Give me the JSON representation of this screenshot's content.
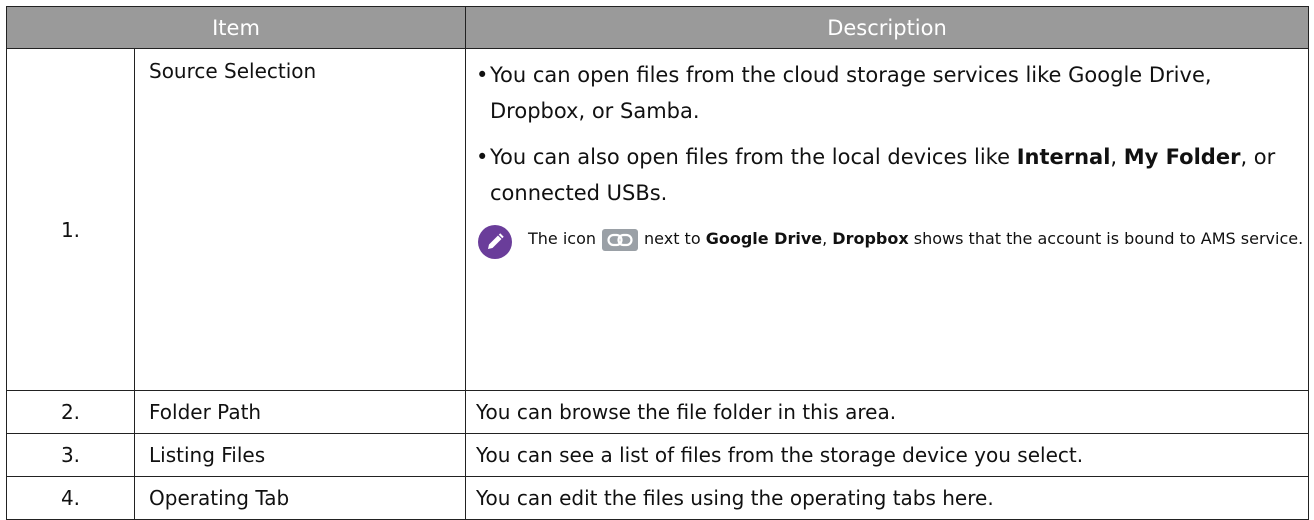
{
  "header": {
    "item": "Item",
    "description": "Description"
  },
  "rows": [
    {
      "number": "1.",
      "name": "Source Selection",
      "bullet_char": "•",
      "bullet1": "You can open files from the cloud storage services like Google Drive, Dropbox, or Samba.",
      "bullet2": {
        "pre": "You can also open files from the local devices like ",
        "bold1": "Internal",
        "sep": ", ",
        "bold2": "My Folder",
        "post": ", or connected USBs."
      },
      "note": {
        "pre": "The icon",
        "mid": "next to",
        "bold1": "Google Drive",
        "sep": ", ",
        "bold2": "Dropbox",
        "post": "shows that the account is bound to AMS service.",
        "note_icon": "pencil-icon",
        "inline_icon": "link-icon"
      }
    },
    {
      "number": "2.",
      "name": "Folder Path",
      "description": "You can browse the file folder in this area."
    },
    {
      "number": "3.",
      "name": "Listing Files",
      "description": "You can see a list of files from the storage device you select."
    },
    {
      "number": "4.",
      "name": "Operating Tab",
      "description": "You can edit the files using the operating tabs here."
    }
  ],
  "colors": {
    "header_bg": "#9a9a9a",
    "note_badge": "#6a3d9a",
    "link_badge": "#9aa0a6"
  }
}
